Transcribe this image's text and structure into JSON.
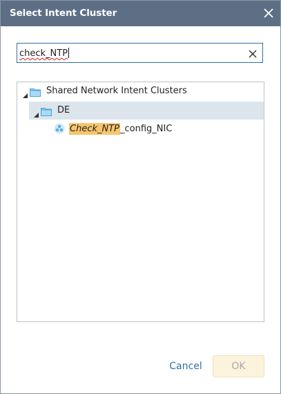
{
  "dialog": {
    "title": "Select Intent Cluster",
    "close_icon": "close-icon"
  },
  "search": {
    "value": "check_NTP",
    "clear_icon": "clear-icon"
  },
  "tree": {
    "root": {
      "label": "Shared Network Intent Clusters",
      "icon": "folder-icon",
      "expanded": true
    },
    "group": {
      "label": "DE",
      "icon": "folder-icon",
      "expanded": true,
      "selected": true
    },
    "leaf": {
      "match": "Check_NTP",
      "rest": "_config_NIC",
      "icon": "intent-cluster-icon"
    }
  },
  "footer": {
    "cancel_label": "Cancel",
    "ok_label": "OK",
    "ok_enabled": false
  },
  "colors": {
    "titlebar": "#5d6f84",
    "accent": "#2f6fa8",
    "highlight": "#f7c56d",
    "selected_row": "#dde5ec",
    "ok_disabled_bg": "#fcf3dc"
  }
}
